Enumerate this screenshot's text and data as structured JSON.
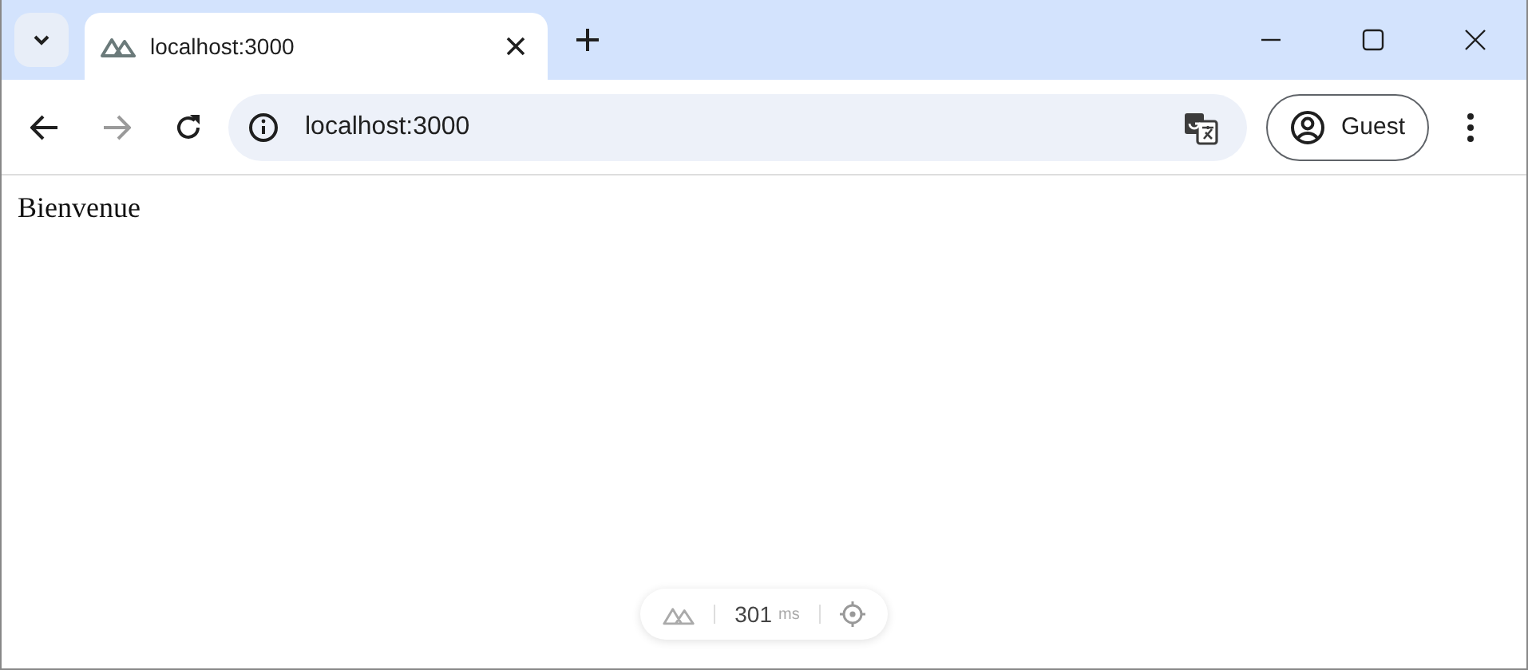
{
  "tabs": [
    {
      "title": "localhost:3000",
      "selected": true
    }
  ],
  "address_bar": {
    "url": "localhost:3000"
  },
  "navigation": {
    "forward_disabled": true
  },
  "profile": {
    "label": "Guest"
  },
  "page": {
    "text": "Bienvenue"
  },
  "devtools_pill": {
    "time": "301",
    "unit": "ms"
  }
}
